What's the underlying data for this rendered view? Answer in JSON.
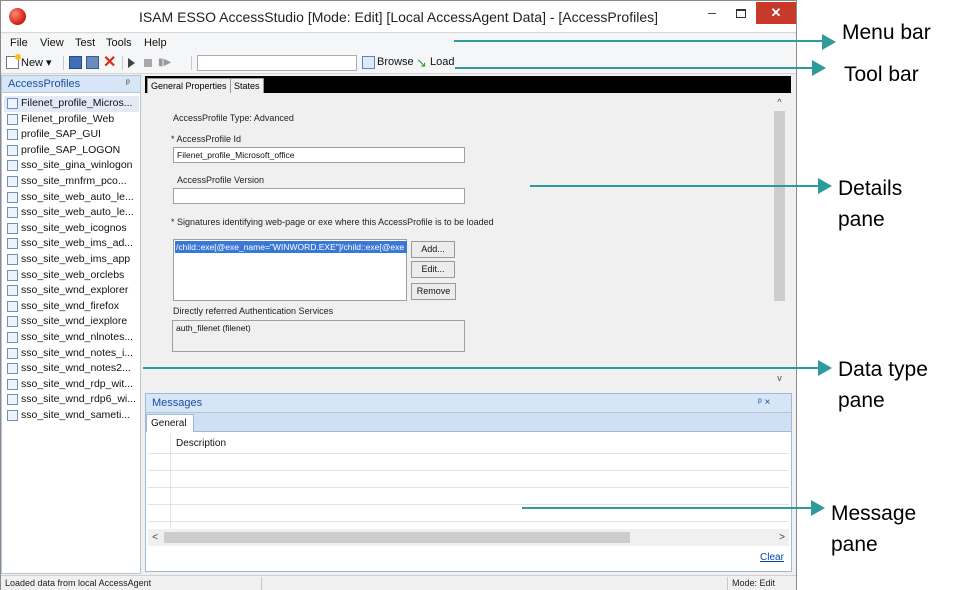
{
  "window": {
    "title": "ISAM ESSO AccessStudio [Mode: Edit] [Local AccessAgent Data] - [AccessProfiles]",
    "min_glyph": "–",
    "close_glyph": "✕"
  },
  "menu": [
    "File",
    "View",
    "Test",
    "Tools",
    "Help"
  ],
  "toolbar": {
    "new_label": "New ▾",
    "browse_label": "Browse",
    "load_label": "Load",
    "address_value": ""
  },
  "left_panel": {
    "title": "AccessProfiles",
    "pin_glyph": "ᵖ",
    "items": [
      "Filenet_profile_Micros...",
      "Filenet_profile_Web",
      "profile_SAP_GUI",
      "profile_SAP_LOGON",
      "sso_site_gina_winlogon",
      "sso_site_mnfrm_pco...",
      "sso_site_web_auto_le...",
      "sso_site_web_auto_le...",
      "sso_site_web_icognos",
      "sso_site_web_ims_ad...",
      "sso_site_web_ims_app",
      "sso_site_web_orclebs",
      "sso_site_wnd_explorer",
      "sso_site_wnd_firefox",
      "sso_site_wnd_iexplore",
      "sso_site_wnd_nlnotes...",
      "sso_site_wnd_notes_i...",
      "sso_site_wnd_notes2...",
      "sso_site_wnd_rdp_wit...",
      "sso_site_wnd_rdp6_wi...",
      "sso_site_wnd_sameti..."
    ]
  },
  "details": {
    "tabs": [
      "General Properties",
      "States"
    ],
    "type_label": "AccessProfile Type: Advanced",
    "id_label": "* AccessProfile Id",
    "id_value": "Filenet_profile_Microsoft_office",
    "version_label": "AccessProfile Version",
    "version_value": "",
    "signatures_label": "* Signatures identifying web-page or exe where this AccessProfile is to be loaded",
    "signature_selected": "/child::exe[@exe_name=\"WINWORD.EXE\"]/child::exe[@exe",
    "add_button": "Add...",
    "edit_button": "Edit...",
    "remove_button": "Remove",
    "auth_label": "Directly referred Authentication Services",
    "auth_value": "auth_filenet (filenet)"
  },
  "messages": {
    "title": "Messages",
    "controls": "ᵖ ×",
    "tab": "General",
    "column": "Description",
    "clear_link": "Clear"
  },
  "status": {
    "left": "Loaded data from local AccessAgent",
    "right": "Mode: Edit"
  },
  "annotations": {
    "menu_bar": "Menu bar",
    "tool_bar": "Tool bar",
    "details_pane": [
      "Details",
      "pane"
    ],
    "data_type_pane": [
      "Data type",
      "pane"
    ],
    "message_pane": [
      "Message",
      "pane"
    ]
  },
  "colors": {
    "annotation": "#2f9a9a",
    "close_button": "#c7392a",
    "selection": "#3a78d6",
    "panel_header": "#d7e6f7"
  }
}
